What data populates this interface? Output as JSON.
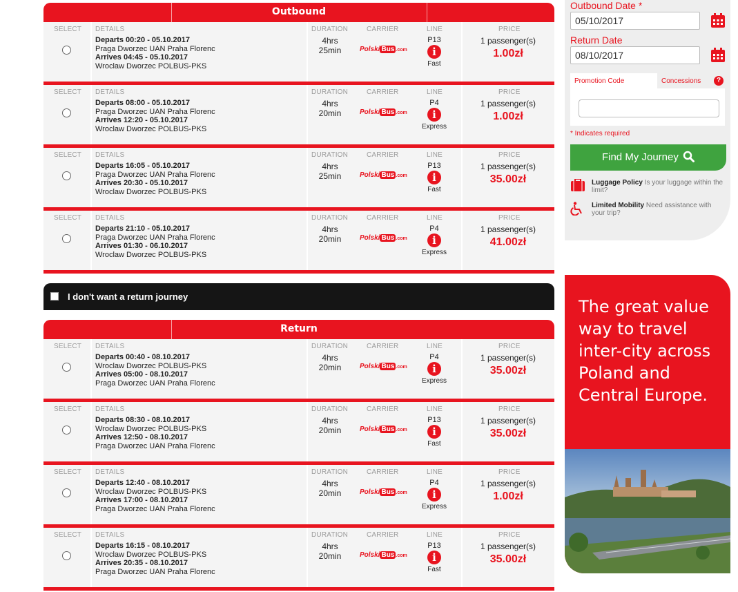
{
  "columns": {
    "select": "SELECT",
    "details": "DETAILS",
    "duration": "DURATION",
    "carrier": "CARRIER",
    "line": "LINE",
    "price": "PRICE"
  },
  "carrier": {
    "name_a": "Polski",
    "name_b": "Bus",
    "name_c": ".com"
  },
  "outbound": {
    "title": "Outbound",
    "rows": [
      {
        "departs": "Departs 00:20 - 05.10.2017",
        "from": "Praga Dworzec UAN Praha Florenc",
        "arrives": "Arrives 04:45 - 05.10.2017",
        "to": "Wroclaw Dworzec POLBUS-PKS",
        "duration_1": "4hrs",
        "duration_2": "25min",
        "line": "P13",
        "line_type": "Fast",
        "passengers": "1 passenger(s)",
        "price": "1.00zł"
      },
      {
        "departs": "Departs 08:00 - 05.10.2017",
        "from": "Praga Dworzec UAN Praha Florenc",
        "arrives": "Arrives 12:20 - 05.10.2017",
        "to": "Wroclaw Dworzec POLBUS-PKS",
        "duration_1": "4hrs",
        "duration_2": "20min",
        "line": "P4",
        "line_type": "Express",
        "passengers": "1 passenger(s)",
        "price": "1.00zł"
      },
      {
        "departs": "Departs 16:05 - 05.10.2017",
        "from": "Praga Dworzec UAN Praha Florenc",
        "arrives": "Arrives 20:30 - 05.10.2017",
        "to": "Wroclaw Dworzec POLBUS-PKS",
        "duration_1": "4hrs",
        "duration_2": "25min",
        "line": "P13",
        "line_type": "Fast",
        "passengers": "1 passenger(s)",
        "price": "35.00zł"
      },
      {
        "departs": "Departs 21:10 - 05.10.2017",
        "from": "Praga Dworzec UAN Praha Florenc",
        "arrives": "Arrives 01:30 - 06.10.2017",
        "to": "Wroclaw Dworzec POLBUS-PKS",
        "duration_1": "4hrs",
        "duration_2": "20min",
        "line": "P4",
        "line_type": "Express",
        "passengers": "1 passenger(s)",
        "price": "41.00zł"
      }
    ]
  },
  "no_return_label": "I don't want a return journey",
  "return": {
    "title": "Return",
    "rows": [
      {
        "departs": "Departs 00:40 - 08.10.2017",
        "from": "Wroclaw Dworzec POLBUS-PKS",
        "arrives": "Arrives 05:00 - 08.10.2017",
        "to": "Praga Dworzec UAN Praha Florenc",
        "duration_1": "4hrs",
        "duration_2": "20min",
        "line": "P4",
        "line_type": "Express",
        "passengers": "1 passenger(s)",
        "price": "35.00zł"
      },
      {
        "departs": "Departs 08:30 - 08.10.2017",
        "from": "Wroclaw Dworzec POLBUS-PKS",
        "arrives": "Arrives 12:50 - 08.10.2017",
        "to": "Praga Dworzec UAN Praha Florenc",
        "duration_1": "4hrs",
        "duration_2": "20min",
        "line": "P13",
        "line_type": "Fast",
        "passengers": "1 passenger(s)",
        "price": "35.00zł"
      },
      {
        "departs": "Departs 12:40 - 08.10.2017",
        "from": "Wroclaw Dworzec POLBUS-PKS",
        "arrives": "Arrives 17:00 - 08.10.2017",
        "to": "Praga Dworzec UAN Praha Florenc",
        "duration_1": "4hrs",
        "duration_2": "20min",
        "line": "P4",
        "line_type": "Express",
        "passengers": "1 passenger(s)",
        "price": "1.00zł"
      },
      {
        "departs": "Departs 16:15 - 08.10.2017",
        "from": "Wroclaw Dworzec POLBUS-PKS",
        "arrives": "Arrives 20:35 - 08.10.2017",
        "to": "Praga Dworzec UAN Praha Florenc",
        "duration_1": "4hrs",
        "duration_2": "20min",
        "line": "P13",
        "line_type": "Fast",
        "passengers": "1 passenger(s)",
        "price": "35.00zł"
      }
    ]
  },
  "search": {
    "outbound_label": "Outbound Date *",
    "outbound_value": "05/10/2017",
    "return_label": "Return Date",
    "return_value": "08/10/2017",
    "promo_tab": "Promotion Code",
    "concessions_tab": "Concessions",
    "required_note": "* Indicates required",
    "find_button": "Find My Journey",
    "luggage_title": "Luggage Policy",
    "luggage_text": "Is your luggage within the limit?",
    "mobility_title": "Limited Mobility",
    "mobility_text": "Need assistance with your trip?"
  },
  "banner": {
    "headline": "The great value way to travel inter-city across Poland and Central Europe."
  },
  "colors": {
    "brand_red": "#e8141f",
    "button_green": "#3fa33f",
    "dark_bar": "#151515"
  }
}
